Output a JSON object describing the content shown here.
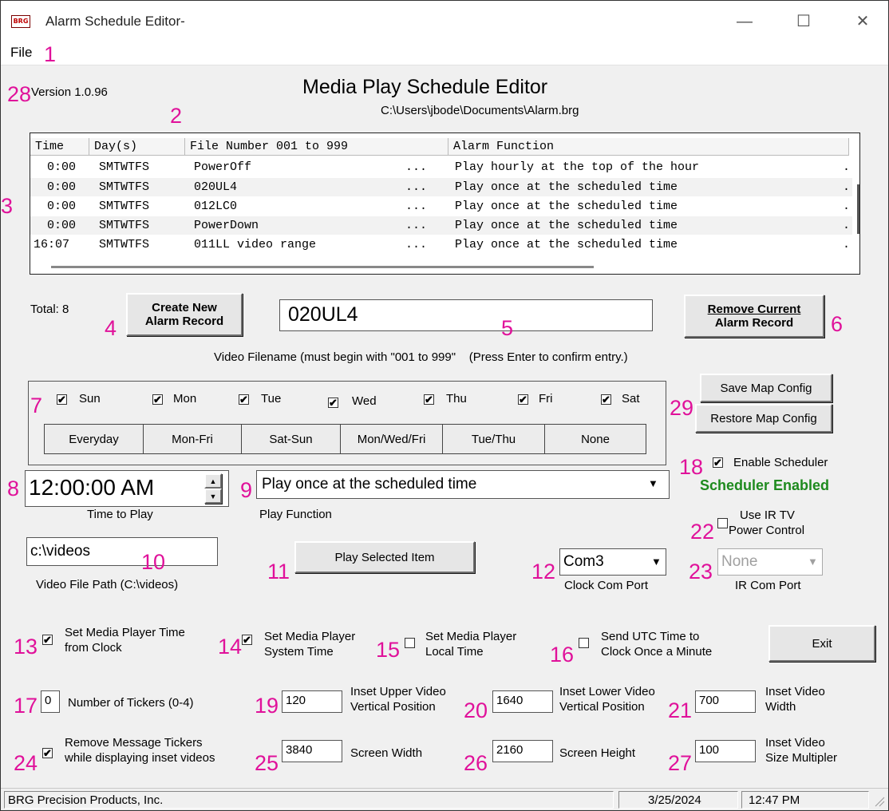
{
  "window": {
    "title": "Alarm Schedule Editor-",
    "logo_text": "BRG",
    "minimize": "—",
    "maximize": "☐",
    "close": "✕"
  },
  "menu": {
    "file": "File"
  },
  "annotations": {
    "n1": "1",
    "n2": "2",
    "n3": "3",
    "n4": "4",
    "n5": "5",
    "n6": "6",
    "n7": "7",
    "n8": "8",
    "n9": "9",
    "n10": "10",
    "n11": "11",
    "n12": "12",
    "n13": "13",
    "n14": "14",
    "n15": "15",
    "n16": "16",
    "n17": "17",
    "n18": "18",
    "n19": "19",
    "n20": "20",
    "n21": "21",
    "n22": "22",
    "n23": "23",
    "n24": "24",
    "n25": "25",
    "n26": "26",
    "n27": "27",
    "n28": "28",
    "n29": "29",
    "color": "#e0119a"
  },
  "header": {
    "version": "Version 1.0.96",
    "title": "Media Play Schedule Editor",
    "path": "C:\\Users\\jbode\\Documents\\Alarm.brg"
  },
  "schedule_table": {
    "columns": [
      "Time",
      "Day(s)",
      "File Number 001 to 999",
      "Alarm Function"
    ],
    "rows": [
      {
        "time": " 0:00",
        "days": "SMTWTFS",
        "file": "PowerOff",
        "dots": "...",
        "function": "Play hourly at the top of the hour",
        "tail": "."
      },
      {
        "time": " 0:00",
        "days": "SMTWTFS",
        "file": "020UL4",
        "dots": "...",
        "function": "Play once at the scheduled time",
        "tail": "."
      },
      {
        "time": " 0:00",
        "days": "SMTWTFS",
        "file": "012LC0",
        "dots": "...",
        "function": "Play once at the scheduled time",
        "tail": "."
      },
      {
        "time": " 0:00",
        "days": "SMTWTFS",
        "file": "PowerDown",
        "dots": "...",
        "function": "Play once at the scheduled time",
        "tail": "."
      },
      {
        "time": "16:07",
        "days": "SMTWTFS",
        "file": "011LL video range",
        "dots": "...",
        "function": "Play once at the scheduled time",
        "tail": "."
      }
    ]
  },
  "record": {
    "total": "Total:  8",
    "create_line1": "Create New",
    "create_line2": "Alarm Record",
    "filename_value": "020UL4",
    "remove_line1": "Remove Current",
    "remove_line2": "Alarm Record",
    "filename_hint": "Video Filename (must begin with \"001 to 999\"    (Press Enter to confirm entry.)"
  },
  "days": {
    "sun": "Sun",
    "mon": "Mon",
    "tue": "Tue",
    "wed": "Wed",
    "thu": "Thu",
    "fri": "Fri",
    "sat": "Sat",
    "check": "✔",
    "presets": [
      "Everyday",
      "Mon-Fri",
      "Sat-Sun",
      "Mon/Wed/Fri",
      "Tue/Thu",
      "None"
    ]
  },
  "map_config": {
    "save": "Save Map Config",
    "restore": "Restore Map Config"
  },
  "scheduler": {
    "enable_label": "Enable Scheduler",
    "status": "Scheduler Enabled",
    "status_color": "#1e8a1e"
  },
  "time": {
    "value": "12:00:00 AM",
    "label": "Time to Play",
    "up": "▲",
    "down": "▼"
  },
  "play_function": {
    "value": "Play once at the scheduled time",
    "label": "Play Function",
    "arrow": "▼"
  },
  "ir_tv": {
    "line1": "Use IR TV",
    "line2": "Power Control"
  },
  "video_path": {
    "value": "c:\\videos",
    "label": "Video File Path (C:\\videos)"
  },
  "play_selected": "Play Selected Item",
  "clock_com": {
    "value": "Com3",
    "label": "Clock Com Port",
    "arrow": "▼"
  },
  "ir_com": {
    "value": "None",
    "label": "IR Com Port",
    "arrow": "▼"
  },
  "options": {
    "set_time_clock_1": "Set Media Player Time",
    "set_time_clock_2": "from Clock",
    "set_system_1": "Set Media Player",
    "set_system_2": "System Time",
    "set_local_1": "Set Media Player",
    "set_local_2": "Local Time",
    "send_utc_1": "Send UTC Time to",
    "send_utc_2": "Clock Once a Minute",
    "exit": "Exit"
  },
  "fields": {
    "tickers_value": "0",
    "tickers_label": "Number of Tickers (0-4)",
    "upper_value": "120",
    "upper_label_1": "Inset Upper Video",
    "upper_label_2": "Vertical Position",
    "lower_value": "1640",
    "lower_label_1": "Inset Lower Video",
    "lower_label_2": "Vertical Position",
    "width_value": "700",
    "width_label_1": "Inset Video",
    "width_label_2": "Width",
    "remove_tickers_1": "Remove Message Tickers",
    "remove_tickers_2": "while displaying inset videos",
    "screen_width_value": "3840",
    "screen_width_label": "Screen Width",
    "screen_height_value": "2160",
    "screen_height_label": "Screen Height",
    "mult_value": "100",
    "mult_label_1": "Inset Video",
    "mult_label_2": "Size Multipler"
  },
  "statusbar": {
    "company": "BRG Precision Products, Inc.",
    "date": "3/25/2024",
    "time": "12:47 PM"
  }
}
